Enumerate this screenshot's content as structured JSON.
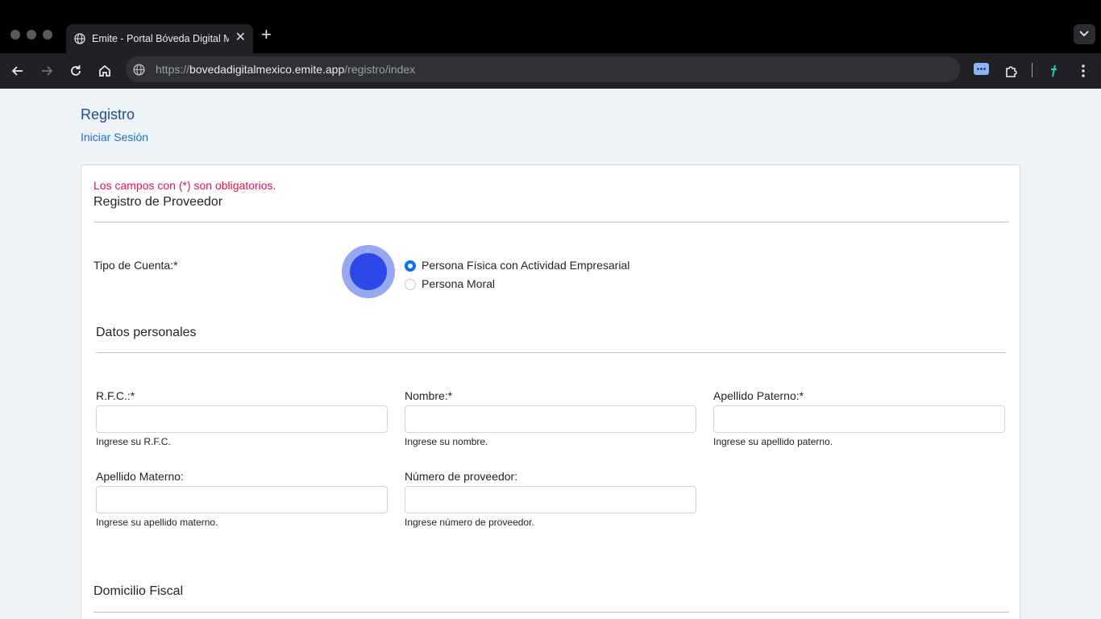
{
  "browser": {
    "tab_title": "Emite - Portal Bóveda Digital México",
    "tab_close": "✕",
    "new_tab": "+",
    "url_scheme": "https://",
    "url_host": "bovedadigitalmexico.emite.app",
    "url_path": "/registro/index",
    "icons": [
      "globe-icon",
      "chevron-down-icon",
      "back-icon",
      "forward-icon",
      "reload-icon",
      "home-icon",
      "site-info-icon",
      "extension-icon",
      "puzzle-icon",
      "profile-icon",
      "kebab-menu-icon"
    ]
  },
  "page": {
    "title": "Registro",
    "login_link": "Iniciar Sesión"
  },
  "form": {
    "required_note": "Los campos con (*) son obligatorios.",
    "title": "Registro de Proveedor",
    "account_type": {
      "label": "Tipo de Cuenta:*",
      "options": [
        {
          "label": "Persona Física con Actividad Empresarial",
          "checked": true
        },
        {
          "label": "Persona Moral",
          "checked": false
        }
      ]
    },
    "personal_section": "Datos personales",
    "fields": {
      "rfc": {
        "label": "R.F.C.:*",
        "help": "Ingrese su R.F.C.",
        "value": ""
      },
      "nombre": {
        "label": "Nombre:*",
        "help": "Ingrese su nombre.",
        "value": ""
      },
      "apellido_paterno": {
        "label": "Apellido Paterno:*",
        "help": "Ingrese su apellido paterno.",
        "value": ""
      },
      "apellido_materno": {
        "label": "Apellido Materno:",
        "help": "Ingrese su apellido materno.",
        "value": ""
      },
      "numero_proveedor": {
        "label": "Número de proveedor:",
        "help": "Ingrese número de proveedor.",
        "value": ""
      }
    },
    "fiscal_section": "Domicilio Fiscal"
  }
}
